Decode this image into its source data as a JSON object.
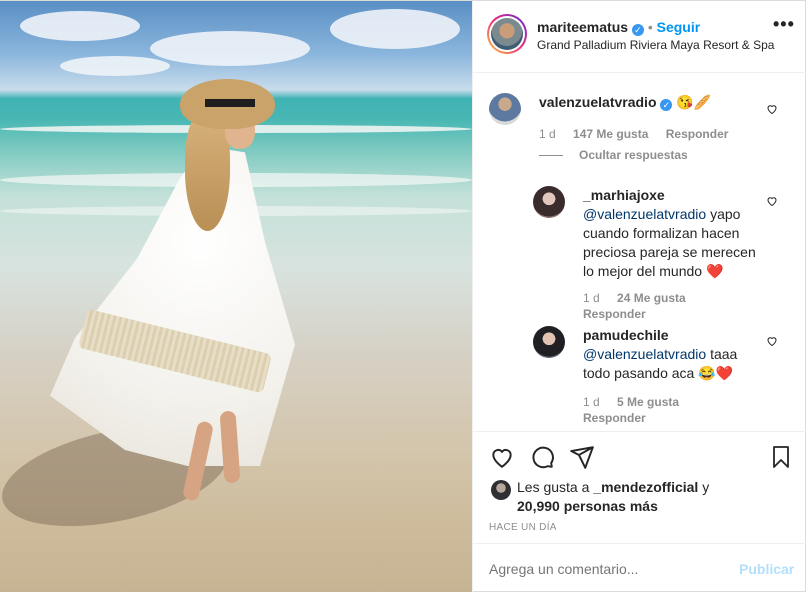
{
  "post": {
    "username": "mariteematus",
    "follow_label": "Seguir",
    "separator": "•",
    "location": "Grand Palladium Riviera Maya Resort & Spa"
  },
  "comments": [
    {
      "username": "valenzuelatvradio",
      "emoji": "😘🥖",
      "time": "1 d",
      "likes": "147 Me gusta",
      "reply_label": "Responder",
      "hide_replies": "Ocultar respuestas"
    }
  ],
  "replies": [
    {
      "username": "_marhiajoxe",
      "mention": "@valenzuelatvradio",
      "text": "yapo cuando formalizan hacen preciosa pareja se merecen lo mejor del mundo ❤️",
      "time": "1 d",
      "likes": "24 Me gusta",
      "reply_label": "Responder"
    },
    {
      "username": "pamudechile",
      "mention": "@valenzuelatvradio",
      "text": "taaa todo pasando aca 😂❤️",
      "time": "1 d",
      "likes": "5 Me gusta",
      "reply_label": "Responder"
    }
  ],
  "likes_summary": {
    "prefix": "Les gusta a",
    "user": "_mendezofficial",
    "conj": "y",
    "others": "20,990 personas más"
  },
  "timestamp": "HACE UN DÍA",
  "composer": {
    "placeholder": "Agrega un comentario...",
    "publish_label": "Publicar"
  },
  "icons": {
    "more": "more-options-icon",
    "like": "heart-icon",
    "comment": "comment-icon",
    "share": "share-icon",
    "save": "bookmark-icon"
  },
  "colors": {
    "accent": "#0095f6",
    "verified": "#3897f0",
    "muted": "#8e8e8e"
  }
}
